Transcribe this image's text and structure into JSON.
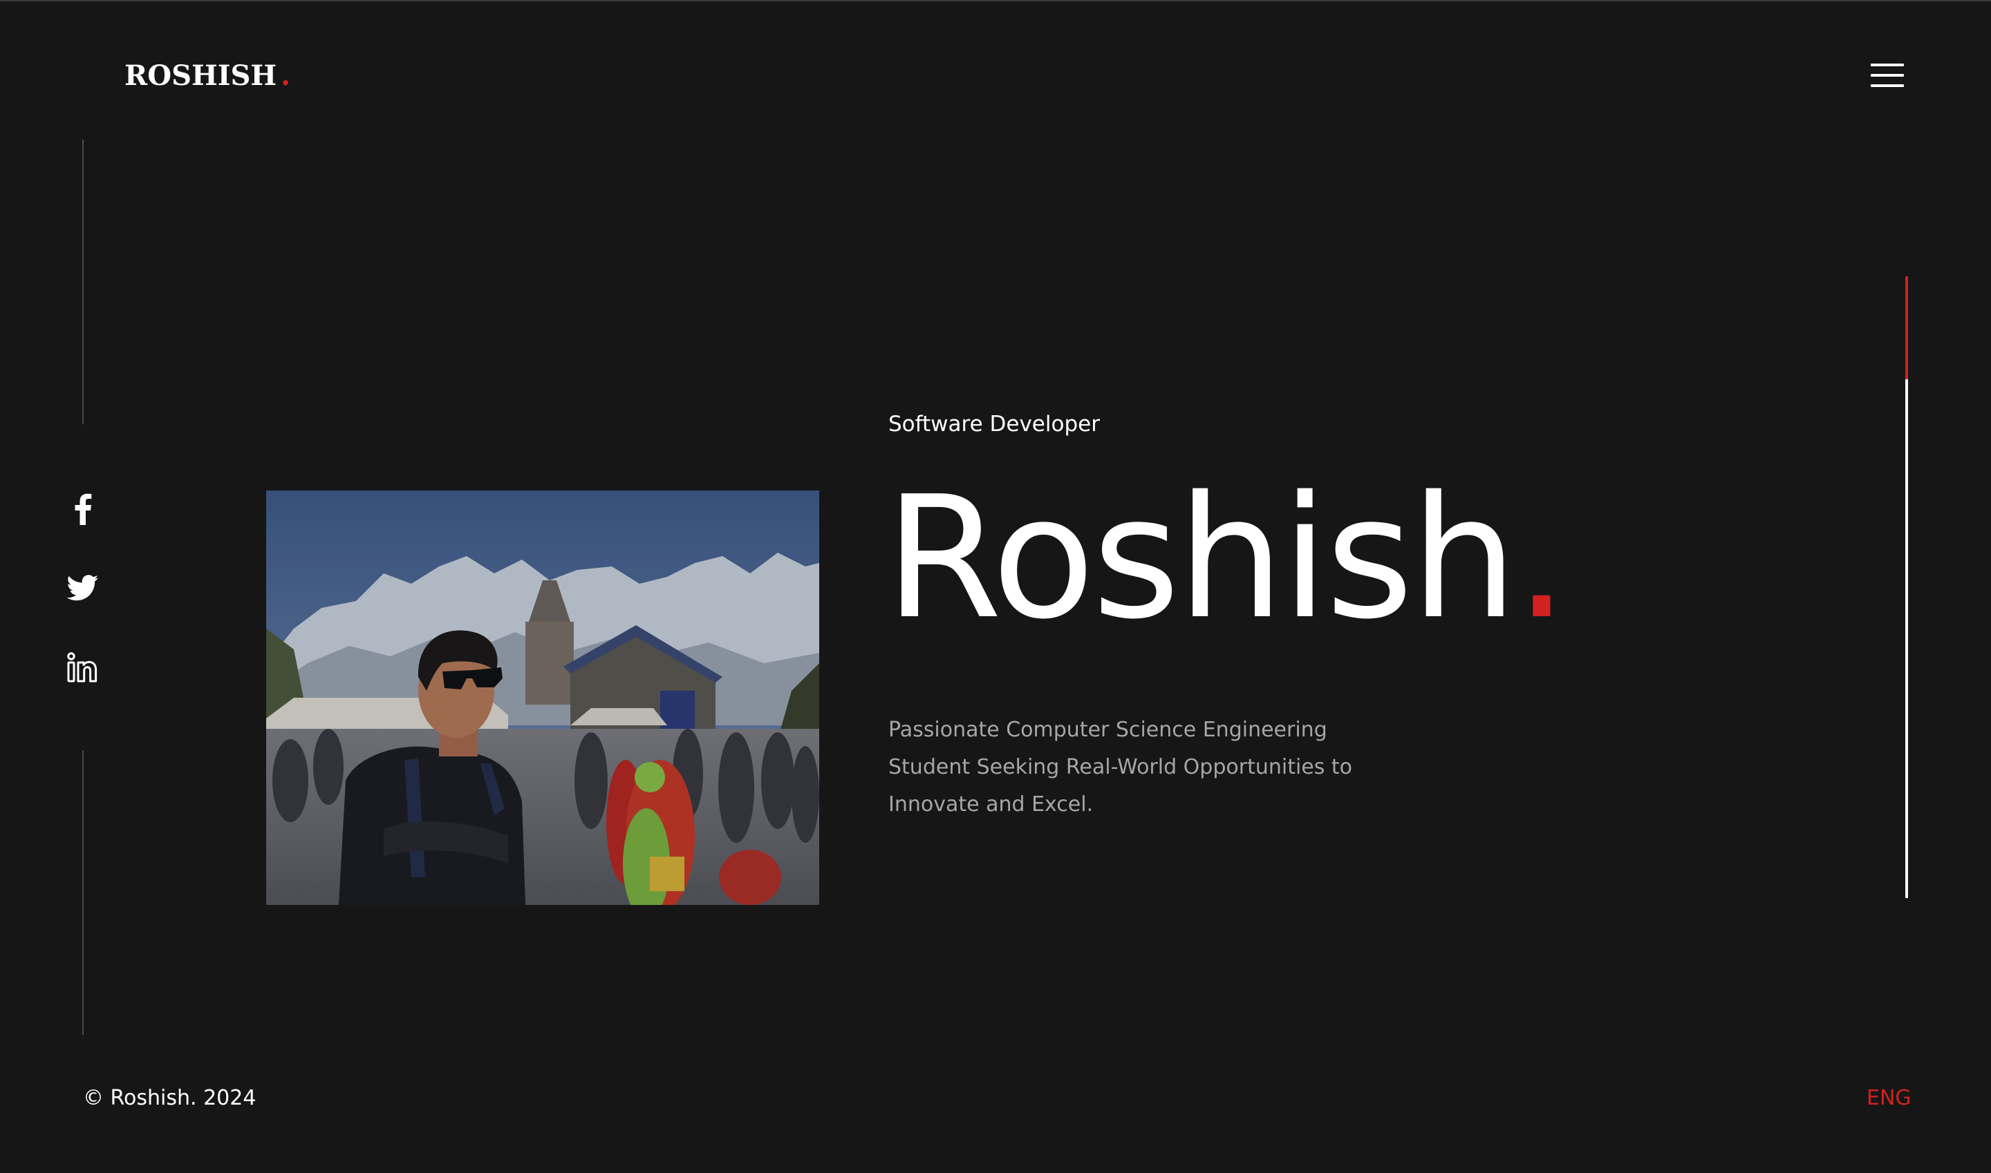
{
  "header": {
    "logo_text": "ROSHISH",
    "logo_dot": ".",
    "menu_icon": "hamburger-menu-icon"
  },
  "social": [
    {
      "icon": "facebook-icon"
    },
    {
      "icon": "twitter-icon"
    },
    {
      "icon": "linkedin-icon"
    }
  ],
  "hero": {
    "subtitle": "Software Developer",
    "name": "Roshish",
    "name_dot": ".",
    "tagline": "Passionate Computer Science Engineering Student Seeking Real-World Opportunities to Innovate and Excel.",
    "photo": "portrait-photo"
  },
  "scroll_progress": 0.165,
  "footer": {
    "copyright": "© Roshish. 2024",
    "language": "ENG"
  },
  "colors": {
    "background": "#161616",
    "accent": "#d1221f",
    "text": "#ffffff",
    "muted_text": "#a6a6a6"
  }
}
